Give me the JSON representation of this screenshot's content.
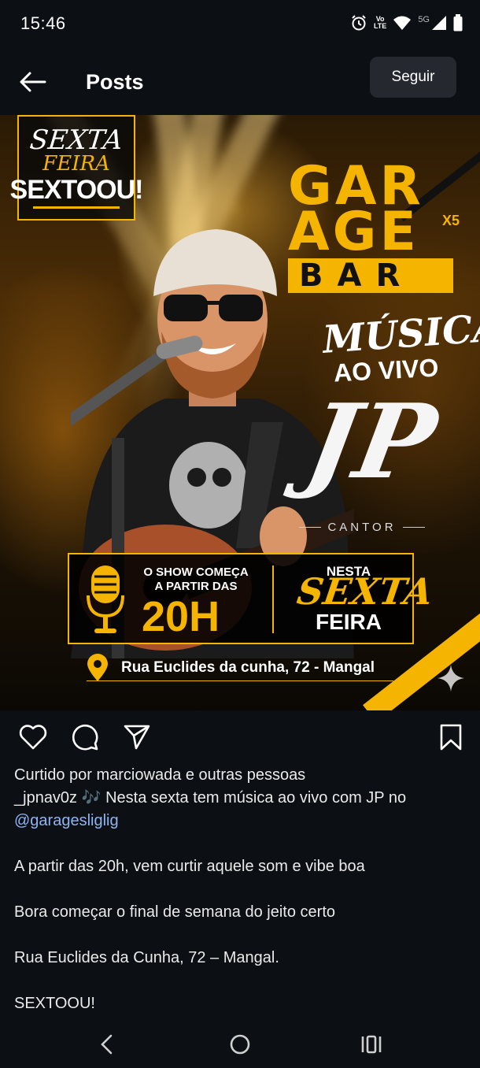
{
  "status_bar": {
    "time": "15:46",
    "volte_top": "Vo",
    "volte_bottom": "LTE",
    "network": "5G",
    "icons": [
      "alarm-icon",
      "volte-icon",
      "wifi-icon",
      "signal-icon",
      "battery-icon"
    ]
  },
  "header": {
    "title": "Posts",
    "follow_label": "Seguir",
    "back_icon": "arrow-left-icon"
  },
  "post": {
    "flyer": {
      "tag_line1": "SEXTA",
      "tag_line2": "FEIRA",
      "tag_line3": "SEXTOOU!",
      "logo_line1": "GAR",
      "logo_line2": "AGE",
      "logo_x5": "X5",
      "logo_line3": "BAR",
      "musica": "MÚSICA",
      "ao_vivo": "AO VIVO",
      "artist": "JP",
      "role": "CANTOR",
      "show_line1": "O SHOW COMEÇA",
      "show_line2": "A PARTIR DAS",
      "show_time": "20H",
      "day_prefix": "NESTA",
      "day_line1": "SEXTA",
      "day_line2": "FEIRA",
      "address": "Rua Euclides da cunha, 72 - Mangal"
    },
    "actions": [
      "heart-icon",
      "comment-icon",
      "share-icon",
      "bookmark-icon"
    ],
    "likes_text": "Curtido por marciowada e outras pessoas",
    "caption": {
      "username": "_jpnav0z",
      "text_line1": " 🎶 Nesta sexta tem música ao vivo com JP no",
      "mention": "@garagesliglig",
      "para1": "A partir das 20h, vem curtir aquele som e vibe boa",
      "para2": "Bora começar o final de semana do jeito certo",
      "para3": "Rua Euclides da Cunha, 72 – Mangal.",
      "para4": "SEXTOOU!"
    }
  },
  "nav_bar": {
    "icons": [
      "back-nav-icon",
      "home-nav-icon",
      "recents-nav-icon"
    ]
  },
  "colors": {
    "background": "#0c0f14",
    "accent": "#f4b400",
    "mention": "#8fb4f3",
    "button": "#25292f"
  }
}
